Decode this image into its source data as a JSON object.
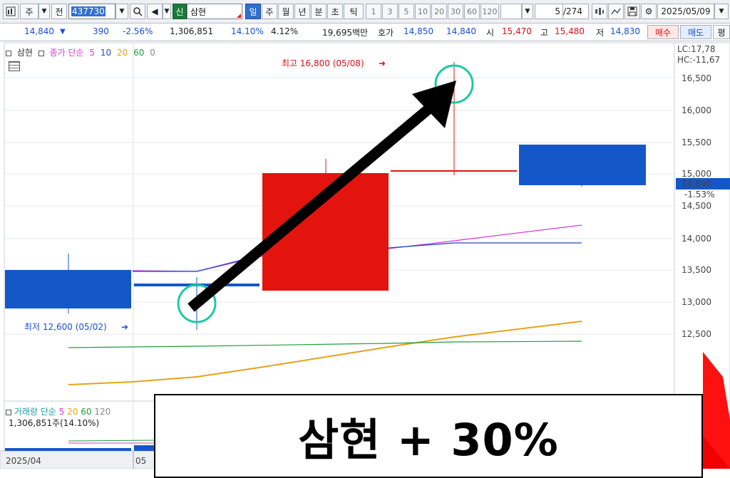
{
  "toolbar": {
    "market": "주",
    "prev": "전",
    "code": "437730",
    "signal": "신",
    "name": "삼현",
    "period_tabs": [
      "일",
      "주",
      "월",
      "년",
      "분",
      "초",
      "틱"
    ],
    "selected_period": "일",
    "intervals": [
      "1",
      "3",
      "5",
      "10",
      "20",
      "30",
      "60",
      "120"
    ],
    "page": "5",
    "page_total": "/274",
    "date": "2025/05/09"
  },
  "quote": {
    "price": "14,840",
    "change": "390",
    "change_pct": "-2.56%",
    "volume": "1,306,851",
    "vol_ratio": "14.10%",
    "turnover_pct": "4.12%",
    "amount": "19,695백만",
    "bid_label": "호가",
    "ask_price": "14,850",
    "bid_price": "14,840",
    "open_label": "시",
    "open": "15,470",
    "high_label": "고",
    "high": "15,480",
    "low_label": "저",
    "low": "14,830",
    "buy_label": "매수",
    "sell_label": "매도",
    "eval_label": "평"
  },
  "legend": {
    "stock": "삼현",
    "ma_title": "종가 단순",
    "ma_periods": [
      "5",
      "10",
      "20",
      "60",
      "0"
    ],
    "volume_title": "거래량 단순",
    "vol_periods": [
      "5",
      "20",
      "60",
      "120"
    ],
    "volume_value": "1,306,851주(14.10%)"
  },
  "annotations": {
    "high": "최고 16,800 (05/08)",
    "low": "최저 12,600 (05/02)",
    "lc": "LC:17,78",
    "hc": "HC:-11,67",
    "current_price": "14,840",
    "current_change": "-1.53%"
  },
  "axis": {
    "price_ticks": [
      "16,500",
      "16,000",
      "15,500",
      "15,000",
      "14,500",
      "14,000",
      "13,500",
      "13,000",
      "12,500"
    ],
    "date_labels": [
      "2025/04",
      "05"
    ]
  },
  "colors": {
    "up": "#e3140d",
    "down": "#1457c8",
    "ma5": "#d63bd6",
    "ma10": "#2546c7",
    "ma20": "#e7a11a",
    "ma60": "#1f9e3a",
    "circle": "#1ccaa0"
  },
  "banner": {
    "text": "삼현 + 30%"
  },
  "icons": [
    "chart-icon",
    "dropdown-icon",
    "search-icon",
    "back-icon",
    "grid-icon",
    "save-icon",
    "gear-icon",
    "arrow-icon"
  ]
}
